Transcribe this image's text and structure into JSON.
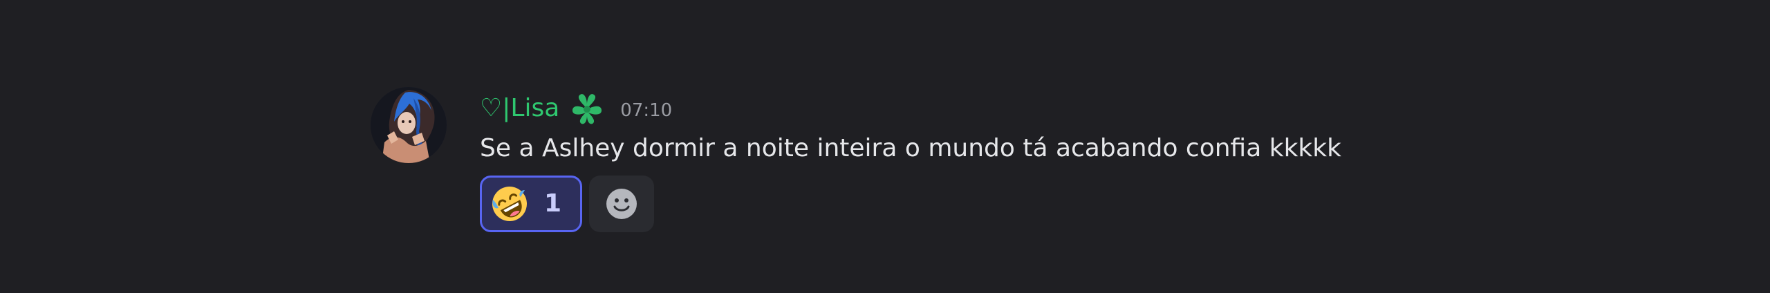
{
  "message": {
    "username": "♡|Lisa",
    "role_icon": "green-flower-icon",
    "timestamp": "07:10",
    "content": "Se a Aslhey dormir a noite inteira o mundo tá acabando confia kkkkk",
    "avatar_icon": "avatar-image",
    "reactions": [
      {
        "emoji": "rolling-on-floor-laughing-emoji",
        "count": "1",
        "active": true
      }
    ],
    "add_reaction_icon": "add-reaction-smiley-icon"
  },
  "colors": {
    "background": "#1f1f23",
    "username": "#2fc870",
    "text": "#e6e7ea",
    "timestamp": "#9a9ca3",
    "reaction_border": "#5865f2",
    "reaction_bg": "#2d2f5c"
  }
}
